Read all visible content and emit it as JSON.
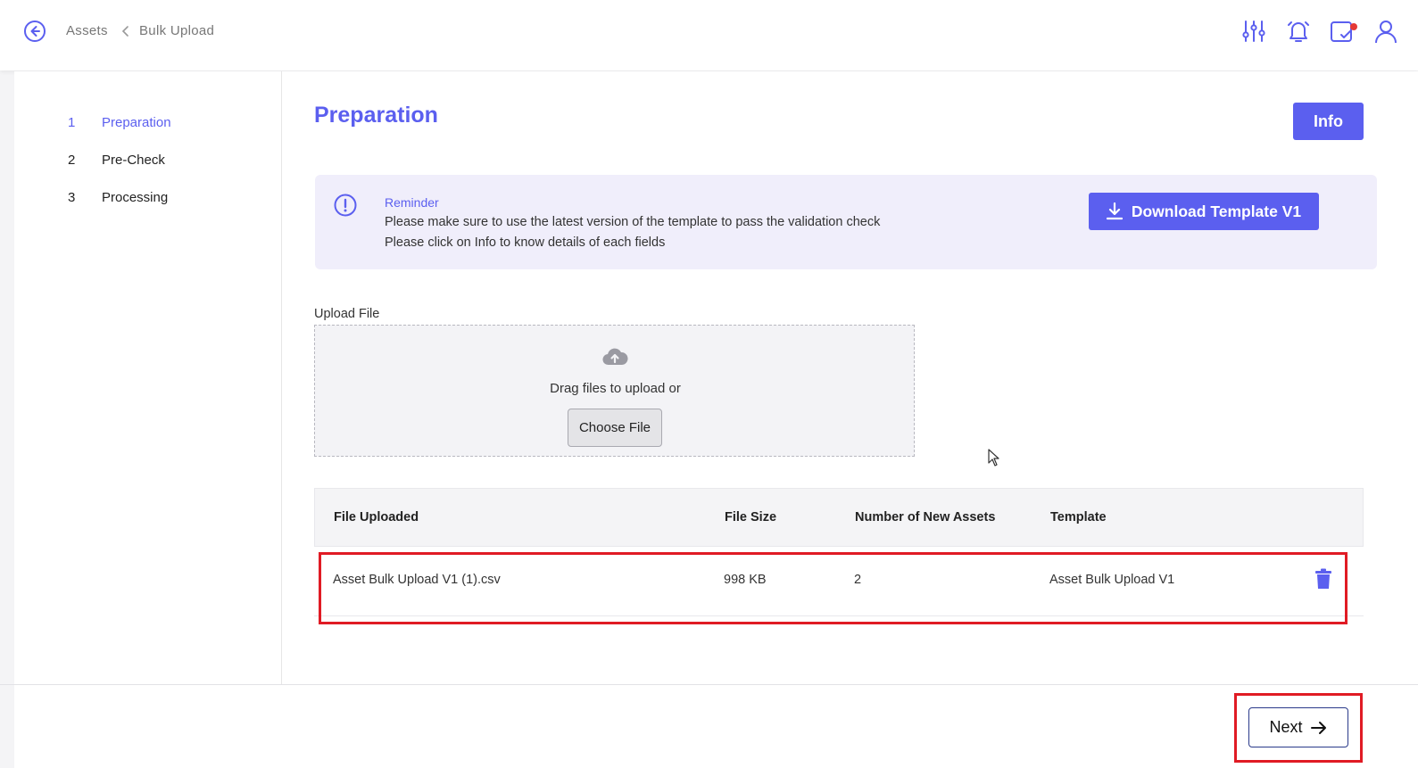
{
  "header": {
    "breadcrumb": [
      "Assets",
      "Bulk Upload"
    ],
    "icons": [
      "back-icon",
      "filter-sliders-icon",
      "bell-icon",
      "calendar-check-icon",
      "user-icon"
    ]
  },
  "sidebar": {
    "steps": [
      {
        "num": "1",
        "label": "Preparation",
        "active": true
      },
      {
        "num": "2",
        "label": "Pre-Check",
        "active": false
      },
      {
        "num": "3",
        "label": "Processing",
        "active": false
      }
    ]
  },
  "main": {
    "title": "Preparation",
    "info_label": "Info"
  },
  "reminder": {
    "title": "Reminder",
    "line1": "Please make sure to use the latest version of the template to pass the validation check",
    "line2": "Please click on Info to know details of each fields",
    "download_label": "Download Template V1"
  },
  "upload": {
    "label": "Upload File",
    "drag_text": "Drag files to upload or",
    "choose_label": "Choose File"
  },
  "table": {
    "headers": [
      "File Uploaded",
      "File Size",
      "Number of New Assets",
      "Template"
    ],
    "rows": [
      {
        "file": "Asset Bulk Upload V1 (1).csv",
        "size": "998 KB",
        "count": "2",
        "template": "Asset Bulk Upload V1"
      }
    ]
  },
  "footer": {
    "next_label": "Next"
  },
  "colors": {
    "accent": "#5b5fef",
    "highlight": "#e01b24",
    "reminder_bg": "#f0eefb"
  }
}
